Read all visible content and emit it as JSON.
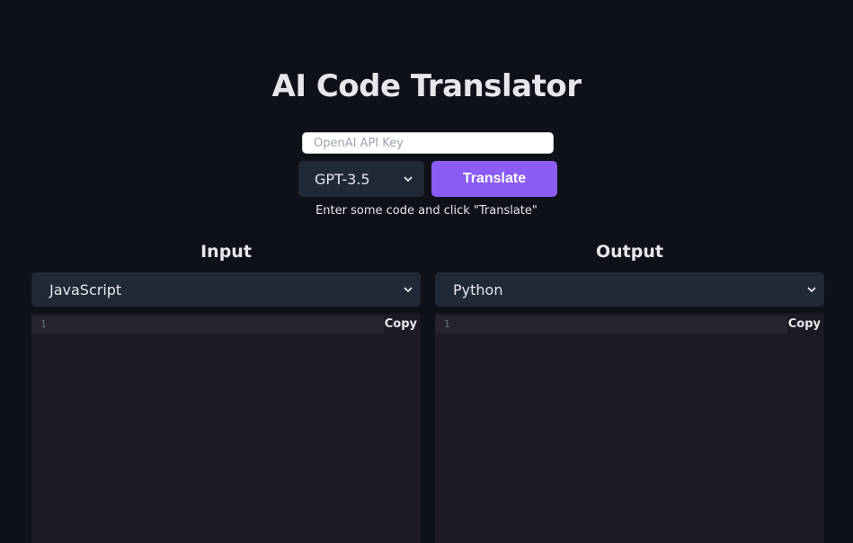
{
  "header": {
    "title": "AI Code Translator"
  },
  "api_key": {
    "value": "",
    "placeholder": "OpenAI API Key"
  },
  "model": {
    "selected": "GPT-3.5"
  },
  "translate_button": {
    "label": "Translate"
  },
  "hint": {
    "text": "Enter some code and click \"Translate\""
  },
  "input": {
    "title": "Input",
    "language": "JavaScript",
    "line_number": "1",
    "copy_label": "Copy"
  },
  "output": {
    "title": "Output",
    "language": "Python",
    "line_number": "1",
    "copy_label": "Copy"
  },
  "colors": {
    "background": "#0f1118",
    "accent": "#8b5cf6",
    "panel": "#1f2937",
    "editor": "#1c1b25"
  }
}
